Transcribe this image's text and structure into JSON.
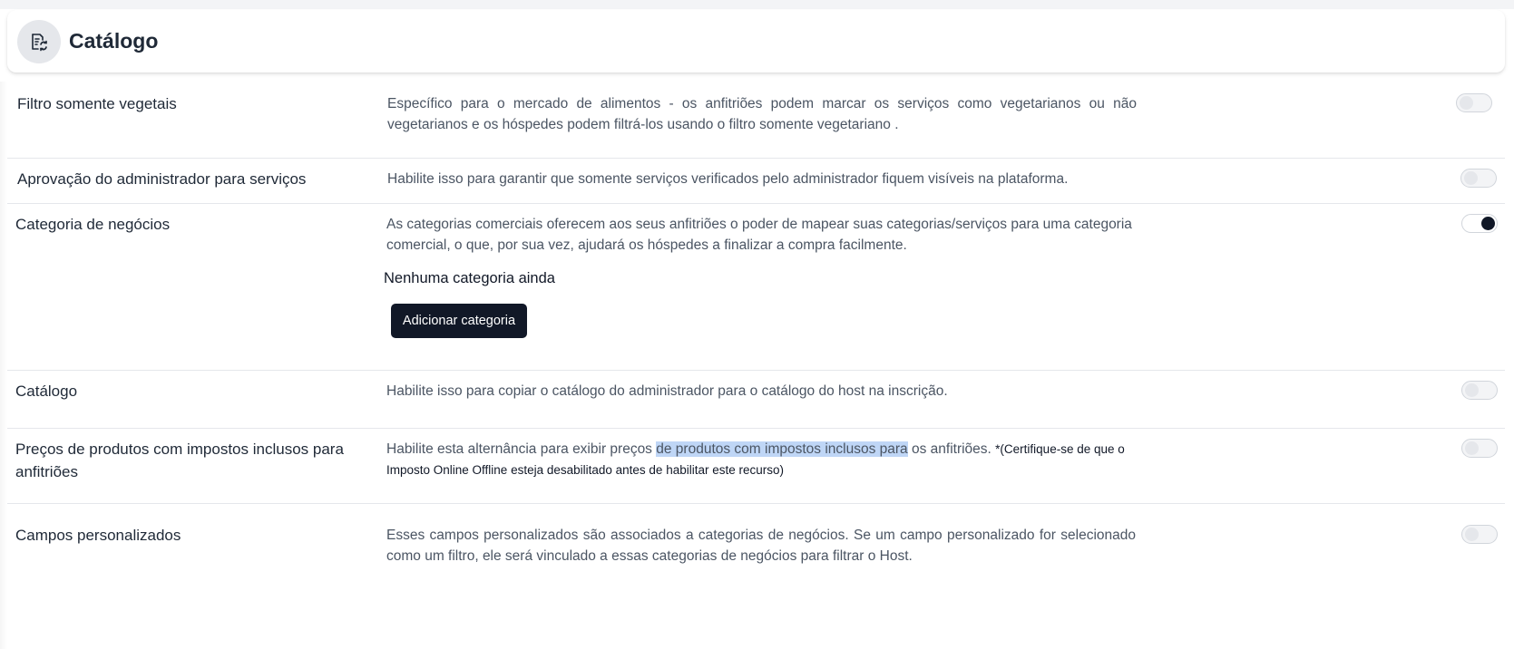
{
  "header": {
    "title": "Catálogo",
    "icon": "catalog-refresh-icon"
  },
  "settings": [
    {
      "label": "Filtro somente vegetais",
      "description": "Específico para o mercado de alimentos - os anfitriões podem marcar os serviços como vegetarianos ou não vegetarianos e os hóspedes podem filtrá-los usando o filtro somente vegetariano .",
      "enabled": false
    },
    {
      "label": "Aprovação do administrador para serviços",
      "description": "Habilite isso para garantir que somente serviços verificados pelo administrador fiquem visíveis na plataforma.",
      "enabled": false
    },
    {
      "label": "Categoria de negócios",
      "description": "As categorias comerciais oferecem aos seus anfitriões o poder de mapear suas categorias/serviços para uma categoria comercial, o que, por sua vez, ajudará os hóspedes a finalizar a compra facilmente.",
      "enabled": true,
      "empty_text": "Nenhuma categoria ainda",
      "add_button": "Adicionar categoria"
    },
    {
      "label": "Catálogo",
      "description": "Habilite isso para copiar o catálogo do administrador para o catálogo do host na inscrição.",
      "enabled": false
    },
    {
      "label": "Preços de produtos com impostos inclusos para anfitriões",
      "description_part1": "Habilite esta alternância para exibir preços ",
      "description_highlight": "de produtos com impostos inclusos para",
      "description_part2": " os anfitriões. ",
      "description_note": "*(Certifique-se de que o Imposto Online Offline esteja desabilitado antes de habilitar este recurso)",
      "enabled": false
    },
    {
      "label": "Campos personalizados",
      "description": "Esses campos personalizados são associados a categorias de negócios. Se um campo personalizado for selecionado como um filtro, ele será vinculado a essas categorias de negócios para filtrar o Host.",
      "enabled": false
    }
  ],
  "colors": {
    "toggle_on": "#111827",
    "button_bg": "#111827",
    "selection_highlight": "#bfd6f6"
  }
}
